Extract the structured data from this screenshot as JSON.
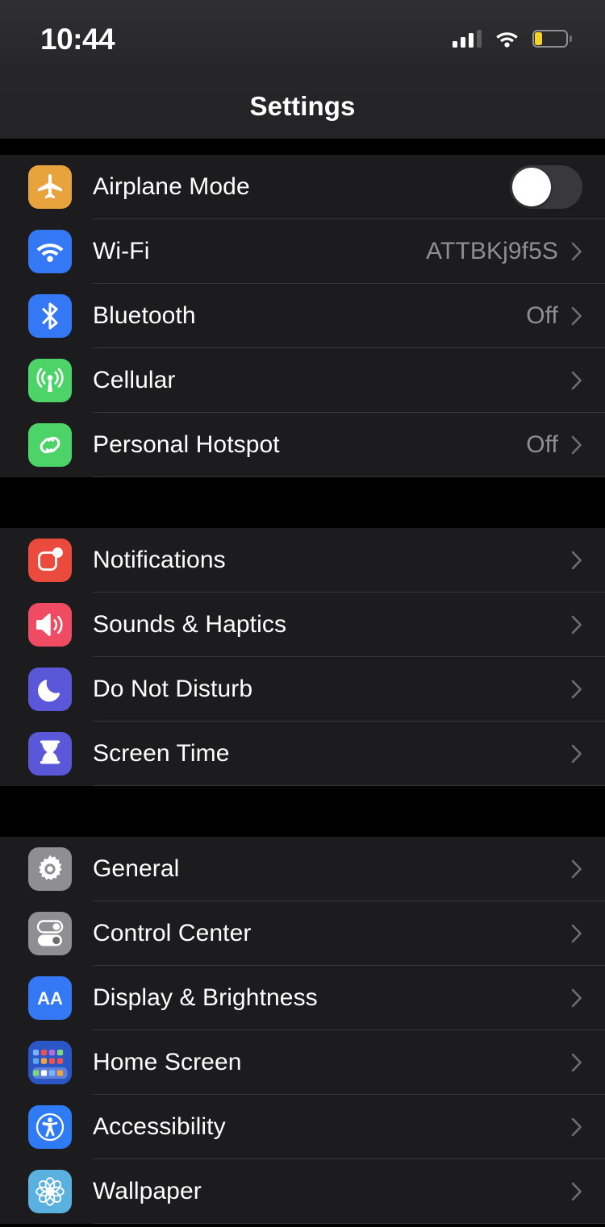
{
  "status_bar": {
    "time": "10:44",
    "signal_icon": "cellular-signal-icon",
    "signal_bars_total": 4,
    "signal_bars_filled": 3,
    "wifi_icon": "wifi-icon",
    "battery_icon": "battery-icon",
    "battery_level_percent": 20,
    "battery_color": "#f6d226"
  },
  "nav": {
    "title": "Settings"
  },
  "groups": [
    {
      "rows": [
        {
          "label": "Airplane Mode",
          "icon": "airplane-icon",
          "icon_color": "#e8a33d",
          "control": "toggle",
          "toggle_on": false,
          "value": ""
        },
        {
          "label": "Wi-Fi",
          "icon": "wifi-icon",
          "icon_color": "#3478f6",
          "control": "chevron",
          "value": "ATTBKj9f5S"
        },
        {
          "label": "Bluetooth",
          "icon": "bluetooth-icon",
          "icon_color": "#3478f6",
          "control": "chevron",
          "value": "Off"
        },
        {
          "label": "Cellular",
          "icon": "cellular-antenna-icon",
          "icon_color": "#4cd469",
          "control": "chevron",
          "value": ""
        },
        {
          "label": "Personal Hotspot",
          "icon": "personal-hotspot-icon",
          "icon_color": "#4cd469",
          "control": "chevron",
          "value": "Off"
        }
      ]
    },
    {
      "rows": [
        {
          "label": "Notifications",
          "icon": "notifications-icon",
          "icon_color": "#eb4b3c",
          "control": "chevron",
          "value": ""
        },
        {
          "label": "Sounds & Haptics",
          "icon": "speaker-icon",
          "icon_color": "#ef4c63",
          "control": "chevron",
          "value": ""
        },
        {
          "label": "Do Not Disturb",
          "icon": "moon-icon",
          "icon_color": "#5a57d8",
          "control": "chevron",
          "value": ""
        },
        {
          "label": "Screen Time",
          "icon": "hourglass-icon",
          "icon_color": "#5a57d8",
          "control": "chevron",
          "value": ""
        }
      ]
    },
    {
      "rows": [
        {
          "label": "General",
          "icon": "gear-icon",
          "icon_color": "#8e8e93",
          "control": "chevron",
          "value": ""
        },
        {
          "label": "Control Center",
          "icon": "control-center-toggles-icon",
          "icon_color": "#8e8e93",
          "control": "chevron",
          "value": ""
        },
        {
          "label": "Display & Brightness",
          "icon": "display-brightness-aa-icon",
          "icon_color": "#3478f6",
          "control": "chevron",
          "value": "",
          "icon_text": "AA"
        },
        {
          "label": "Home Screen",
          "icon": "home-screen-grid-icon",
          "icon_color": "#2a56c6",
          "control": "chevron",
          "value": ""
        },
        {
          "label": "Accessibility",
          "icon": "accessibility-icon",
          "icon_color": "#2f7bf6",
          "control": "chevron",
          "value": ""
        },
        {
          "label": "Wallpaper",
          "icon": "wallpaper-flower-icon",
          "icon_color": "#5ab0de",
          "control": "chevron",
          "value": ""
        }
      ]
    }
  ]
}
